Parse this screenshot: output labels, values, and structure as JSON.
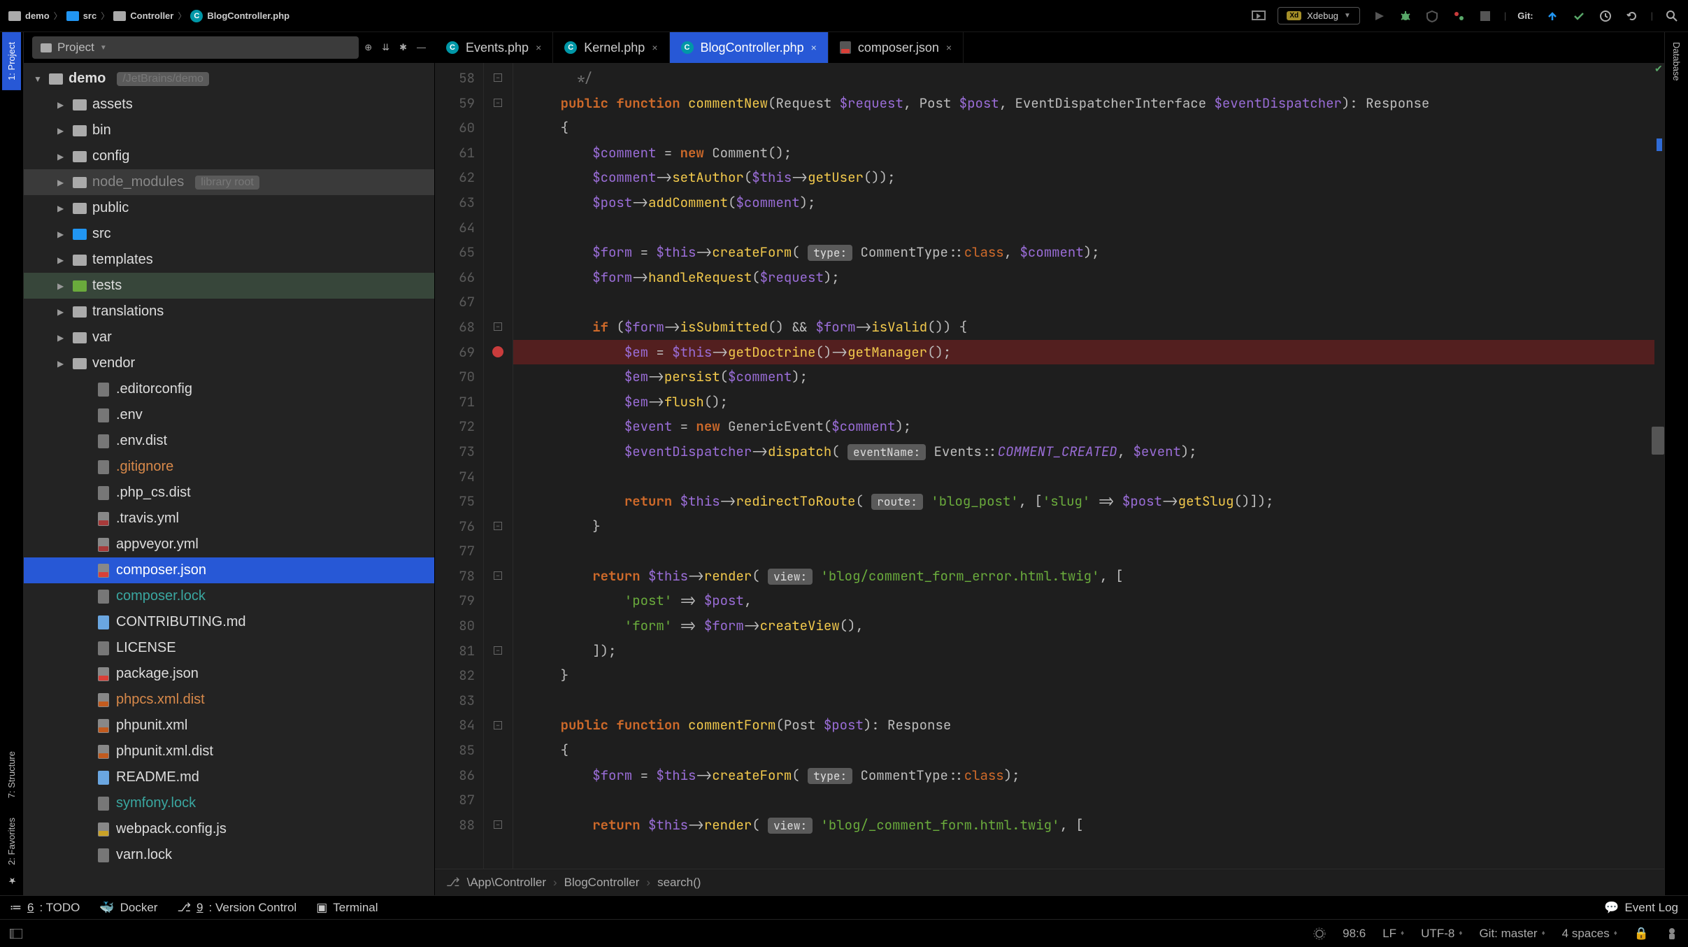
{
  "breadcrumbs": [
    {
      "type": "folder-gray",
      "label": "demo"
    },
    {
      "type": "folder-blue",
      "label": "src"
    },
    {
      "type": "folder-gray",
      "label": "Controller"
    },
    {
      "type": "php",
      "label": "BlogController.php"
    }
  ],
  "top": {
    "xdebug": "Xdebug",
    "git_label": "Git:"
  },
  "project_header": {
    "title": "Project"
  },
  "left_rail": {
    "project": "1: Project",
    "structure": "7: Structure",
    "favorites": "2: Favorites"
  },
  "right_rail": {
    "database": "Database"
  },
  "tree": [
    {
      "depth": 0,
      "arrow": "▼",
      "icon": "gray-folder",
      "label": "demo",
      "hint": "/JetBrains/demo",
      "bold": true
    },
    {
      "depth": 1,
      "arrow": "▶",
      "icon": "gray-folder",
      "label": "assets"
    },
    {
      "depth": 1,
      "arrow": "▶",
      "icon": "gray-folder",
      "label": "bin"
    },
    {
      "depth": 1,
      "arrow": "▶",
      "icon": "gray-folder",
      "label": "config"
    },
    {
      "depth": 1,
      "arrow": "▶",
      "icon": "gray-folder",
      "label": "node_modules",
      "hint": "library root",
      "rowclass": "dim",
      "labelcolor": "#888"
    },
    {
      "depth": 1,
      "arrow": "▶",
      "icon": "gray-folder",
      "label": "public"
    },
    {
      "depth": 1,
      "arrow": "▶",
      "icon": "blue-folder",
      "label": "src"
    },
    {
      "depth": 1,
      "arrow": "▶",
      "icon": "gray-folder",
      "label": "templates"
    },
    {
      "depth": 1,
      "arrow": "▶",
      "icon": "green-folder",
      "label": "tests",
      "rowclass": "hover"
    },
    {
      "depth": 1,
      "arrow": "▶",
      "icon": "gray-folder",
      "label": "translations"
    },
    {
      "depth": 1,
      "arrow": "▶",
      "icon": "gray-folder",
      "label": "var"
    },
    {
      "depth": 1,
      "arrow": "▶",
      "icon": "gray-folder",
      "label": "vendor"
    },
    {
      "depth": 2,
      "arrow": "",
      "icon": "file txt",
      "label": ".editorconfig"
    },
    {
      "depth": 2,
      "arrow": "",
      "icon": "file txt",
      "label": ".env"
    },
    {
      "depth": 2,
      "arrow": "",
      "icon": "file txt",
      "label": ".env.dist"
    },
    {
      "depth": 2,
      "arrow": "",
      "icon": "file txt",
      "label": ".gitignore",
      "labelclass": "orange"
    },
    {
      "depth": 2,
      "arrow": "",
      "icon": "file txt",
      "label": ".php_cs.dist"
    },
    {
      "depth": 2,
      "arrow": "",
      "icon": "file yml",
      "label": ".travis.yml"
    },
    {
      "depth": 2,
      "arrow": "",
      "icon": "file yml",
      "label": "appveyor.yml"
    },
    {
      "depth": 2,
      "arrow": "",
      "icon": "file jsonf",
      "label": "composer.json",
      "rowclass": "selected"
    },
    {
      "depth": 2,
      "arrow": "",
      "icon": "file txt",
      "label": "composer.lock",
      "labelclass": "teal"
    },
    {
      "depth": 2,
      "arrow": "",
      "icon": "file md",
      "label": "CONTRIBUTING.md"
    },
    {
      "depth": 2,
      "arrow": "",
      "icon": "file txt",
      "label": "LICENSE"
    },
    {
      "depth": 2,
      "arrow": "",
      "icon": "file jsonf",
      "label": "package.json"
    },
    {
      "depth": 2,
      "arrow": "",
      "icon": "file xml",
      "label": "phpcs.xml.dist",
      "labelclass": "orange"
    },
    {
      "depth": 2,
      "arrow": "",
      "icon": "file xml",
      "label": "phpunit.xml",
      "labelclass": "#888"
    },
    {
      "depth": 2,
      "arrow": "",
      "icon": "file xml",
      "label": "phpunit.xml.dist"
    },
    {
      "depth": 2,
      "arrow": "",
      "icon": "file md",
      "label": "README.md"
    },
    {
      "depth": 2,
      "arrow": "",
      "icon": "file txt",
      "label": "symfony.lock",
      "labelclass": "teal"
    },
    {
      "depth": 2,
      "arrow": "",
      "icon": "file js",
      "label": "webpack.config.js"
    },
    {
      "depth": 2,
      "arrow": "",
      "icon": "file txt",
      "label": "varn.lock",
      "labelclass": "#888"
    }
  ],
  "tabs": [
    {
      "icon": "php",
      "label": "Events.php",
      "active": false
    },
    {
      "icon": "php",
      "label": "Kernel.php",
      "active": false
    },
    {
      "icon": "php",
      "label": "BlogController.php",
      "active": true
    },
    {
      "icon": "json",
      "label": "composer.json",
      "active": false
    }
  ],
  "gutter": {
    "start": 58,
    "end": 88,
    "breakpoint": 69
  },
  "code": [
    {
      "n": 58,
      "html": "      <span class='cmt'>*/</span>"
    },
    {
      "n": 59,
      "html": "    <span class='kw'>public</span> <span class='kw'>function</span> <span class='fn'>commentNew</span>(Request <span class='var'>$request</span>, Post <span class='var'>$post</span>, EventDispatcherInterface <span class='var'>$eventDispatcher</span>): Response"
    },
    {
      "n": 60,
      "html": "    {"
    },
    {
      "n": 61,
      "html": "        <span class='var'>$comment</span> = <span class='kw'>new</span> Comment();"
    },
    {
      "n": 62,
      "html": "        <span class='var'>$comment</span>-&gt;<span class='method'>setAuthor</span>(<span class='var'>$this</span>-&gt;<span class='method'>getUser</span>());"
    },
    {
      "n": 63,
      "html": "        <span class='var'>$post</span>-&gt;<span class='method'>addComment</span>(<span class='var'>$comment</span>);"
    },
    {
      "n": 64,
      "html": ""
    },
    {
      "n": 65,
      "html": "        <span class='var'>$form</span> = <span class='var'>$this</span>-&gt;<span class='method'>createForm</span>( <span class='hint'>type:</span> CommentType::<span class='this'>class</span>, <span class='var'>$comment</span>);"
    },
    {
      "n": 66,
      "html": "        <span class='var'>$form</span>-&gt;<span class='method'>handleRequest</span>(<span class='var'>$request</span>);"
    },
    {
      "n": 67,
      "html": ""
    },
    {
      "n": 68,
      "html": "        <span class='kw'>if</span> (<span class='var'>$form</span>-&gt;<span class='method'>isSubmitted</span>() &amp;&amp; <span class='var'>$form</span>-&gt;<span class='method'>isValid</span>()) {"
    },
    {
      "n": 69,
      "html": "            <span class='var'>$em</span> = <span class='var'>$this</span>-&gt;<span class='method'>getDoctrine</span>()-&gt;<span class='method'>getManager</span>();",
      "hl": true
    },
    {
      "n": 70,
      "html": "            <span class='var'>$em</span>-&gt;<span class='method'>persist</span>(<span class='var'>$comment</span>);"
    },
    {
      "n": 71,
      "html": "            <span class='var'>$em</span>-&gt;<span class='method'>flush</span>();"
    },
    {
      "n": 72,
      "html": "            <span class='var'>$event</span> = <span class='kw'>new</span> GenericEvent(<span class='var'>$comment</span>);"
    },
    {
      "n": 73,
      "html": "            <span class='var'>$eventDispatcher</span>-&gt;<span class='method'>dispatch</span>( <span class='hint'>eventName:</span> Events::<span class='const'>COMMENT_CREATED</span>, <span class='var'>$event</span>);"
    },
    {
      "n": 74,
      "html": ""
    },
    {
      "n": 75,
      "html": "            <span class='kw'>return</span> <span class='var'>$this</span>-&gt;<span class='method'>redirectToRoute</span>( <span class='hint'>route:</span> <span class='str'>'blog_post'</span>, [<span class='str'>'slug'</span> =&gt; <span class='var'>$post</span>-&gt;<span class='method'>getSlug</span>()]);"
    },
    {
      "n": 76,
      "html": "        }"
    },
    {
      "n": 77,
      "html": ""
    },
    {
      "n": 78,
      "html": "        <span class='kw'>return</span> <span class='var'>$this</span>-&gt;<span class='method'>render</span>( <span class='hint'>view:</span> <span class='str'>'blog/comment_form_error.html.twig'</span>, ["
    },
    {
      "n": 79,
      "html": "            <span class='str'>'post'</span> =&gt; <span class='var'>$post</span>,"
    },
    {
      "n": 80,
      "html": "            <span class='str'>'form'</span> =&gt; <span class='var'>$form</span>-&gt;<span class='method'>createView</span>(),"
    },
    {
      "n": 81,
      "html": "        ]);"
    },
    {
      "n": 82,
      "html": "    }"
    },
    {
      "n": 83,
      "html": ""
    },
    {
      "n": 84,
      "html": "    <span class='kw'>public</span> <span class='kw'>function</span> <span class='fn'>commentForm</span>(Post <span class='var'>$post</span>): Response"
    },
    {
      "n": 85,
      "html": "    {"
    },
    {
      "n": 86,
      "html": "        <span class='var'>$form</span> = <span class='var'>$this</span>-&gt;<span class='method'>createForm</span>( <span class='hint'>type:</span> CommentType::<span class='this'>class</span>);"
    },
    {
      "n": 87,
      "html": ""
    },
    {
      "n": 88,
      "html": "        <span class='kw'>return</span> <span class='var'>$this</span>-&gt;<span class='method'>render</span>( <span class='hint'>view:</span> <span class='str'>'blog/_comment_form.html.twig'</span>, ["
    }
  ],
  "code_crumb": [
    "\\App\\Controller",
    "BlogController",
    "search()"
  ],
  "bottombar": {
    "todo": "6: TODO",
    "docker": "Docker",
    "vcs": "9: Version Control",
    "terminal": "Terminal",
    "eventlog": "Event Log"
  },
  "statusbar": {
    "pos": "98:6",
    "lineend": "LF",
    "encoding": "UTF-8",
    "git": "Git: master",
    "indent": "4 spaces"
  }
}
